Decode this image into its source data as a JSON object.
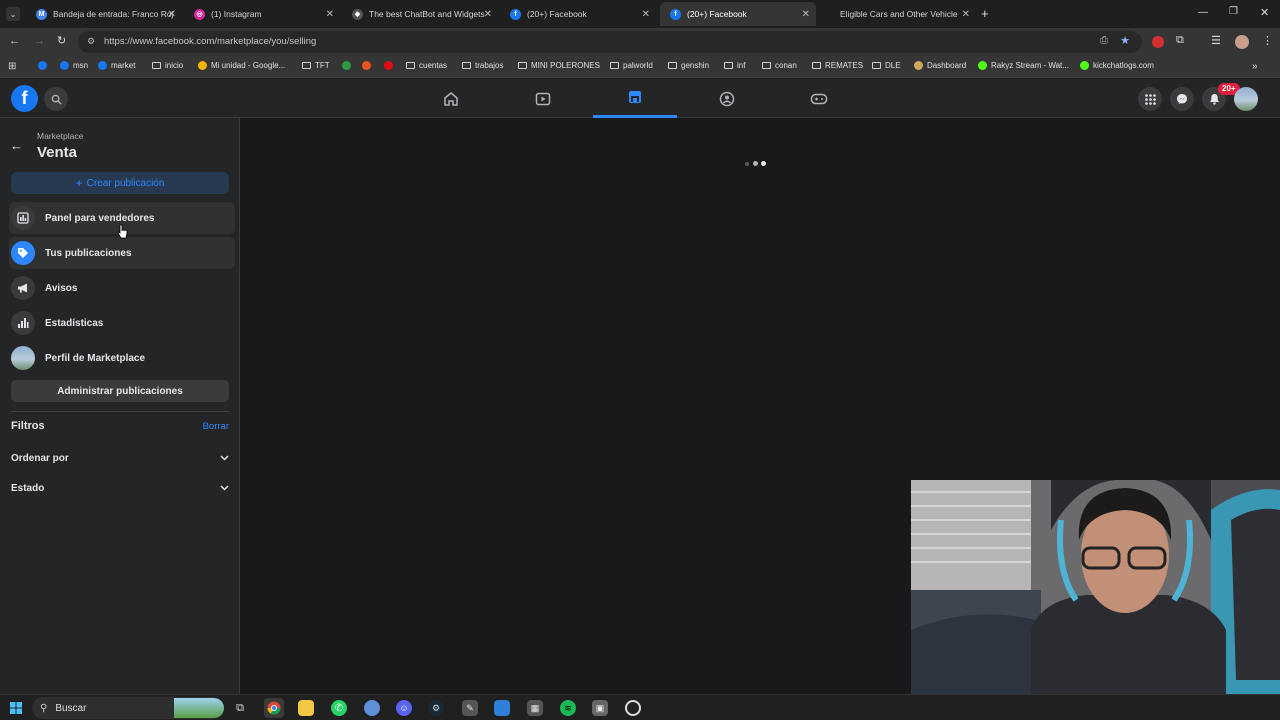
{
  "browser": {
    "tabs": [
      {
        "title": "Bandeja de entrada: Franco Roj",
        "favicon": "gmail-icon",
        "color": "#4285f4",
        "glyph": "M"
      },
      {
        "title": "(1) Instagram",
        "favicon": "instagram-icon",
        "color": "#d6249f",
        "glyph": "◎"
      },
      {
        "title": "The best ChatBot and Widgets",
        "favicon": "chatbot-icon",
        "color": "#555555",
        "glyph": "◆"
      },
      {
        "title": "(20+) Facebook",
        "favicon": "facebook-icon",
        "color": "#1877f2",
        "glyph": "f"
      },
      {
        "title": "(20+) Facebook",
        "favicon": "facebook-icon",
        "color": "#1877f2",
        "glyph": "f"
      },
      {
        "title": "Eligible Cars and Other Vehicle",
        "favicon": "",
        "color": "",
        "glyph": ""
      }
    ],
    "url": "https://www.facebook.com/marketplace/you/selling",
    "bookmarks": [
      {
        "label": "",
        "icon": "facebook-icon",
        "color": "#1877f2"
      },
      {
        "label": "msn",
        "icon": "facebook-icon",
        "color": "#1877f2"
      },
      {
        "label": "market",
        "icon": "facebook-icon",
        "color": "#1877f2"
      },
      {
        "label": "inicio",
        "icon": "folder-icon",
        "color": ""
      },
      {
        "label": "Mi unidad - Google...",
        "icon": "google-drive-icon",
        "color": "#f4b400"
      },
      {
        "label": "TFT",
        "icon": "folder-icon",
        "color": ""
      },
      {
        "label": "",
        "icon": "green-leaf-icon",
        "color": "#2e9a3f"
      },
      {
        "label": "",
        "icon": "orange-circle-icon",
        "color": "#e8541e"
      },
      {
        "label": "",
        "icon": "red-n-icon",
        "color": "#e50914"
      },
      {
        "label": "cuentas",
        "icon": "folder-icon",
        "color": ""
      },
      {
        "label": "trabajos",
        "icon": "folder-icon",
        "color": ""
      },
      {
        "label": "MINI POLERONES",
        "icon": "folder-icon",
        "color": ""
      },
      {
        "label": "palworld",
        "icon": "folder-icon",
        "color": ""
      },
      {
        "label": "genshin",
        "icon": "folder-icon",
        "color": ""
      },
      {
        "label": "inf",
        "icon": "folder-icon",
        "color": ""
      },
      {
        "label": "conan",
        "icon": "folder-icon",
        "color": ""
      },
      {
        "label": "REMATES",
        "icon": "folder-icon",
        "color": ""
      },
      {
        "label": "DLE",
        "icon": "folder-icon",
        "color": ""
      },
      {
        "label": "Dashboard",
        "icon": "dashboard-icon",
        "color": "#cfa85a"
      },
      {
        "label": "Rakyz Stream - Wat...",
        "icon": "kick-icon",
        "color": "#53fc18"
      },
      {
        "label": "kickchatlogs.com",
        "icon": "kick-icon",
        "color": "#53fc18"
      }
    ]
  },
  "facebook": {
    "notifications_badge": "20+",
    "accent": "#2d88ff",
    "sidebar": {
      "breadcrumb": "Marketplace",
      "title": "Venta",
      "create_button": "Crear publicación",
      "items": [
        {
          "label": "Panel para vendedores",
          "icon": "seller-dashboard-icon"
        },
        {
          "label": "Tus publicaciones",
          "icon": "tag-icon"
        },
        {
          "label": "Avisos",
          "icon": "megaphone-icon"
        },
        {
          "label": "Estadísticas",
          "icon": "bar-chart-icon"
        },
        {
          "label": "Perfil de Marketplace",
          "icon": "profile-avatar-icon"
        }
      ],
      "manage_button": "Administrar publicaciones",
      "filters_title": "Filtros",
      "clear_link": "Borrar",
      "filters": [
        {
          "label": "Ordenar por"
        },
        {
          "label": "Estado"
        }
      ]
    }
  },
  "taskbar": {
    "search_placeholder": "Buscar"
  }
}
